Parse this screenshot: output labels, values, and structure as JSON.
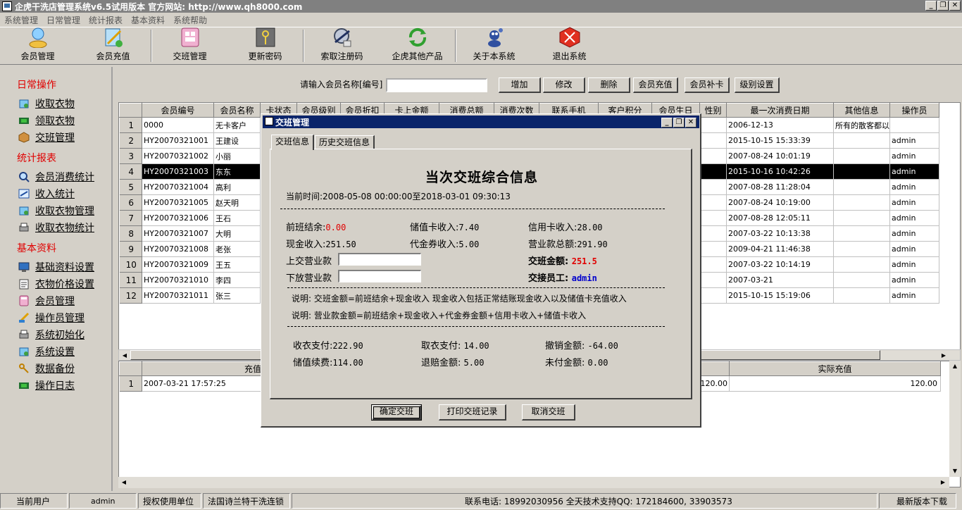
{
  "window": {
    "title": "企虎干洗店管理系统v6.5试用版本  官方网站: http://www.qh8000.com",
    "min_label": "_",
    "max_label": "❐",
    "close_label": "✕"
  },
  "menu": [
    "系统管理",
    "日常管理",
    "统计报表",
    "基本资料",
    "系统帮助"
  ],
  "toolbar": [
    {
      "label": "会员管理",
      "icon": "member-icon"
    },
    {
      "label": "会员充值",
      "icon": "recharge-icon"
    },
    {
      "label": "交班管理",
      "icon": "shift-icon"
    },
    {
      "label": "更新密码",
      "icon": "key-icon"
    },
    {
      "label": "索取注册码",
      "icon": "register-icon"
    },
    {
      "label": "企虎其他产品",
      "icon": "refresh-icon"
    },
    {
      "label": "关于本系统",
      "icon": "about-icon"
    },
    {
      "label": "退出系统",
      "icon": "exit-icon"
    }
  ],
  "sidebar": [
    {
      "group": "日常操作",
      "items": [
        "收取衣物",
        "领取衣物",
        "交班管理"
      ]
    },
    {
      "group": "统计报表",
      "items": [
        "会员消费统计",
        "收入统计",
        "收取衣物管理",
        "收取衣物统计"
      ]
    },
    {
      "group": "基本资料",
      "items": [
        "基础资料设置",
        "衣物价格设置",
        "会员管理",
        "操作员管理",
        "系统初始化",
        "系统设置",
        "数据备份",
        "操作日志"
      ]
    }
  ],
  "search": {
    "label": "请输入会员名称[编号]",
    "value": "",
    "buttons": [
      "增加",
      "修改",
      "删除",
      "会员充值",
      "会员补卡",
      "级别设置"
    ]
  },
  "grid": {
    "columns": [
      "会员编号",
      "会员名称",
      "卡状态",
      "会员级别",
      "会员折扣",
      "卡上金额",
      "消费总额",
      "消费次数",
      "联系手机",
      "客户积分",
      "会员生日",
      "性别",
      "最一次消费日期",
      "其他信息",
      "操作员"
    ],
    "rows": [
      {
        "n": "1",
        "id": "0000",
        "name": "无卡客户",
        "last": "2006-12-13",
        "other": "所有的散客都以",
        "op": ""
      },
      {
        "n": "2",
        "id": "HY20070321001",
        "name": "王建设",
        "last": "2015-10-15 15:33:39",
        "other": "",
        "op": "admin"
      },
      {
        "n": "3",
        "id": "HY20070321002",
        "name": "小丽",
        "last": "2007-08-24 10:01:19",
        "other": "",
        "op": "admin"
      },
      {
        "n": "4",
        "id": "HY20070321003",
        "name": "东东",
        "last": "2015-10-16 10:42:26",
        "other": "",
        "op": "admin"
      },
      {
        "n": "5",
        "id": "HY20070321004",
        "name": "高利",
        "last": "2007-08-28 11:28:04",
        "other": "",
        "op": "admin"
      },
      {
        "n": "6",
        "id": "HY20070321005",
        "name": "赵天明",
        "last": "2007-08-24 10:19:00",
        "other": "",
        "op": "admin"
      },
      {
        "n": "7",
        "id": "HY20070321006",
        "name": "王石",
        "last": "2007-08-28 12:05:11",
        "other": "",
        "op": "admin"
      },
      {
        "n": "8",
        "id": "HY20070321007",
        "name": "大明",
        "last": "2007-03-22 10:13:38",
        "other": "",
        "op": "admin"
      },
      {
        "n": "9",
        "id": "HY20070321008",
        "name": "老张",
        "last": "2009-04-21 11:46:38",
        "other": "",
        "op": "admin"
      },
      {
        "n": "10",
        "id": "HY20070321009",
        "name": "王五",
        "last": "2007-03-22 10:14:19",
        "other": "",
        "op": "admin"
      },
      {
        "n": "11",
        "id": "HY20070321010",
        "name": "李四",
        "last": "2007-03-21",
        "other": "",
        "op": "admin"
      },
      {
        "n": "12",
        "id": "HY20070321011",
        "name": "张三",
        "last": "2015-10-15 15:19:06",
        "other": "",
        "op": "admin"
      }
    ]
  },
  "grid2": {
    "col1": "充值",
    "col2": "实际充值",
    "row": {
      "n": "1",
      "date": "2007-03-21 17:57:25",
      "amount": "120.00",
      "actual": "120.00"
    }
  },
  "dialog": {
    "title": "交班管理",
    "tabs": [
      "交班信息",
      "历史交班信息"
    ],
    "heading": "当次交班综合信息",
    "current_time_label": "当前时间:",
    "current_time_value": "2008-05-08 00:00:00至2018-03-01 09:30:13",
    "prev_balance_label": "前班结余:",
    "prev_balance": "0.00",
    "stored_card_label": "储值卡收入:",
    "stored_card": "7.40",
    "credit_card_label": "信用卡收入:",
    "credit_card": "28.00",
    "cash_label": "现金收入:",
    "cash": "251.50",
    "voucher_label": "代金券收入:",
    "voucher": "5.00",
    "total_label": "营业款总额:",
    "total": "291.90",
    "handover_label": "上交营业款",
    "handover_value": "",
    "release_label": "下放营业款",
    "release_value": "",
    "shift_amount_label": "交班金额:",
    "shift_amount": "251.5",
    "receiver_label": "交接员工:",
    "receiver": "admin",
    "note1": "说明: 交班金额=前班结余+现金收入    现金收入包括正常结账现金收入以及储值卡充值收入",
    "note2": "说明: 营业款金额=前班结余+现金收入+代金券金额+信用卡收入+储值卡收入",
    "collect_label": "收衣支付:",
    "collect": "222.90",
    "pickup_label": "取衣支付:",
    "pickup": "14.00",
    "cancel_label": "撤销金额:",
    "cancel": "-64.00",
    "stored_fee_label": "储值续费:",
    "stored_fee": "114.00",
    "refund_label": "退赔金额:",
    "refund": "5.00",
    "unpaid_label": "未付金额:",
    "unpaid": "0.00",
    "buttons": [
      "确定交班",
      "打印交班记录",
      "取消交班"
    ]
  },
  "status": {
    "user_label": "当前用户",
    "user": "admin",
    "licensed_label": "授权使用单位",
    "licensed": "法国诗兰特干洗连锁",
    "phone": "联系电话: 18992030956   全天技术支持QQ: 172184600, 33903573",
    "download": "最新版本下载"
  }
}
